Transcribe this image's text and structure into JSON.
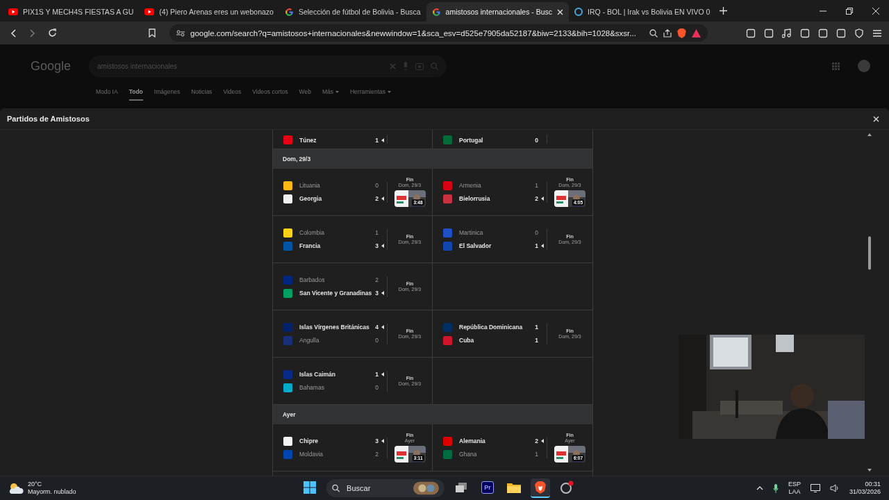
{
  "browser": {
    "tabs": [
      {
        "title": "PIX1S Y MECH4S FIESTAS A GU",
        "kind": "youtube",
        "selected": false
      },
      {
        "title": "(4) Piero Arenas eres un webonazo",
        "kind": "youtube",
        "selected": false
      },
      {
        "title": "Selección de fútbol de Bolivia - Busca",
        "kind": "google",
        "selected": false
      },
      {
        "title": "amistosos internacionales - Busc",
        "kind": "google",
        "selected": true
      },
      {
        "title": "IRQ - BOL | Irak vs Bolivia EN VIVO 0",
        "kind": "site",
        "selected": false
      }
    ],
    "address": "google.com/search?q=amistosos+internacionales&newwindow=1&sca_esv=d525e7905da52187&biw=2133&bih=1028&sxsr..."
  },
  "google": {
    "logo": "Google",
    "query": "amistosos internacionales",
    "nav": [
      {
        "label": "Modo IA",
        "selected": false,
        "dropdown": false
      },
      {
        "label": "Todo",
        "selected": true,
        "dropdown": false
      },
      {
        "label": "Imágenes",
        "selected": false,
        "dropdown": false
      },
      {
        "label": "Noticias",
        "selected": false,
        "dropdown": false
      },
      {
        "label": "Videos",
        "selected": false,
        "dropdown": false
      },
      {
        "label": "Videos cortos",
        "selected": false,
        "dropdown": false
      },
      {
        "label": "Web",
        "selected": false,
        "dropdown": false
      },
      {
        "label": "Más",
        "selected": false,
        "dropdown": true
      },
      {
        "label": "Herramientas",
        "selected": false,
        "dropdown": true
      }
    ]
  },
  "panel": {
    "title": "Partidos de Amistosos",
    "sections": [
      {
        "rows": [
          {
            "kind": "cut",
            "left": {
              "teams": [
                {
                  "name": "Túnez",
                  "score": "1",
                  "bold": true,
                  "winner": true,
                  "color": "#e70013"
                }
              ]
            },
            "right": {
              "teams": [
                {
                  "name": "Portugal",
                  "score": "0",
                  "bold": true,
                  "winner": false,
                  "color": "#046a38"
                }
              ]
            }
          }
        ]
      },
      {
        "header": "Dom, 29/3",
        "rows": [
          {
            "kind": "full",
            "left": {
              "teams": [
                {
                  "name": "Lituania",
                  "score": "0",
                  "bold": false,
                  "winner": false,
                  "color": "#fdb913"
                },
                {
                  "name": "Georgia",
                  "score": "2",
                  "bold": true,
                  "winner": true,
                  "color": "#f2f2f2"
                }
              ],
              "status": "Fin",
              "date": "Dom, 29/3",
              "video": "3:48"
            },
            "right": {
              "teams": [
                {
                  "name": "Armenia",
                  "score": "1",
                  "bold": false,
                  "winner": false,
                  "color": "#d90012"
                },
                {
                  "name": "Bielorrusia",
                  "score": "2",
                  "bold": true,
                  "winner": true,
                  "color": "#c8313e"
                }
              ],
              "status": "Fin",
              "date": "Dom, 29/3",
              "video": "4:05"
            }
          },
          {
            "kind": "full",
            "left": {
              "teams": [
                {
                  "name": "Colombia",
                  "score": "1",
                  "bold": false,
                  "winner": false,
                  "color": "#fcd116"
                },
                {
                  "name": "Francia",
                  "score": "3",
                  "bold": true,
                  "winner": true,
                  "color": "#0055a4"
                }
              ],
              "status": "Fin",
              "date": "Dom, 29/3"
            },
            "right": {
              "teams": [
                {
                  "name": "Martinica",
                  "score": "0",
                  "bold": false,
                  "winner": false,
                  "color": "#1e50c8"
                },
                {
                  "name": "El Salvador",
                  "score": "1",
                  "bold": true,
                  "winner": true,
                  "color": "#0f47af"
                }
              ],
              "status": "Fin",
              "date": "Dom, 29/3"
            }
          },
          {
            "kind": "full",
            "left": {
              "teams": [
                {
                  "name": "Barbados",
                  "score": "2",
                  "bold": false,
                  "winner": false,
                  "color": "#00267f"
                },
                {
                  "name": "San Vicente y Granadinas",
                  "score": "3",
                  "bold": true,
                  "winner": true,
                  "color": "#009e60"
                }
              ],
              "status": "Fin",
              "date": "Dom, 29/3"
            }
          },
          {
            "kind": "full",
            "left": {
              "teams": [
                {
                  "name": "Islas Vírgenes Británicas",
                  "score": "4",
                  "bold": true,
                  "winner": true,
                  "color": "#012169"
                },
                {
                  "name": "Angulla",
                  "score": "0",
                  "bold": false,
                  "winner": false,
                  "color": "#1a2f7a"
                }
              ],
              "status": "Fin",
              "date": "Dom, 29/3"
            },
            "right": {
              "teams": [
                {
                  "name": "República Dominicana",
                  "score": "1",
                  "bold": true,
                  "winner": false,
                  "color": "#002d62"
                },
                {
                  "name": "Cuba",
                  "score": "1",
                  "bold": true,
                  "winner": false,
                  "color": "#cf142b"
                }
              ],
              "status": "Fin",
              "date": "Dom, 29/3"
            }
          },
          {
            "kind": "full",
            "left": {
              "teams": [
                {
                  "name": "Islas Caimán",
                  "score": "1",
                  "bold": true,
                  "winner": true,
                  "color": "#0a2a8a"
                },
                {
                  "name": "Bahamas",
                  "score": "0",
                  "bold": false,
                  "winner": false,
                  "color": "#00abc9"
                }
              ],
              "status": "Fin",
              "date": "Dom, 29/3"
            }
          }
        ]
      },
      {
        "header": "Ayer",
        "rows": [
          {
            "kind": "full",
            "left": {
              "teams": [
                {
                  "name": "Chipre",
                  "score": "3",
                  "bold": true,
                  "winner": true,
                  "color": "#f4f4f4"
                },
                {
                  "name": "Moldavia",
                  "score": "2",
                  "bold": false,
                  "winner": false,
                  "color": "#0046ae"
                }
              ],
              "status": "Fin",
              "date": "Ayer",
              "video": "3:11"
            },
            "right": {
              "teams": [
                {
                  "name": "Alemania",
                  "score": "2",
                  "bold": true,
                  "winner": true,
                  "color": "#dd0000"
                },
                {
                  "name": "Ghana",
                  "score": "1",
                  "bold": false,
                  "winner": false,
                  "color": "#006b3f"
                }
              ],
              "status": "Fin",
              "date": "Ayer",
              "video": "6:07"
            }
          }
        ]
      }
    ]
  },
  "taskbar": {
    "temp": "20°C",
    "weather": "Mayorm. nublado",
    "search_placeholder": "Buscar",
    "apps": [
      {
        "kind": "taskview",
        "active": false
      },
      {
        "kind": "premiere",
        "label": "Pr",
        "active": false
      },
      {
        "kind": "folder",
        "active": false
      },
      {
        "kind": "brave",
        "active": true
      },
      {
        "kind": "app",
        "active": false
      }
    ],
    "lang": "ESP",
    "layout": "LAA",
    "time": "00:31",
    "date": "31/03/2026"
  }
}
